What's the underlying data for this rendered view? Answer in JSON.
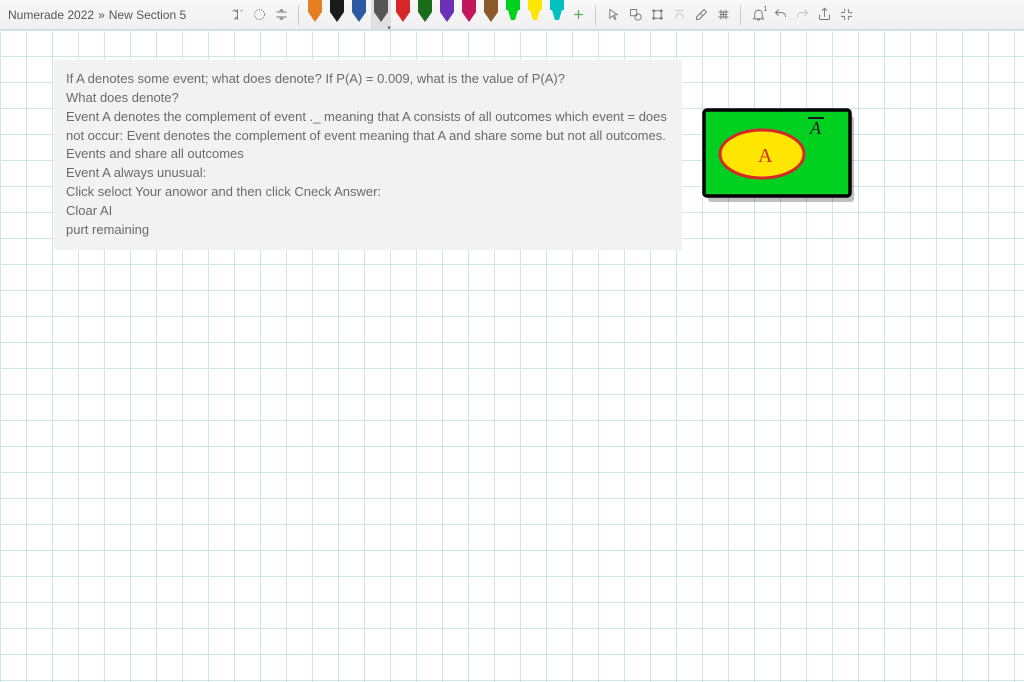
{
  "breadcrumb": {
    "project": "Numerade 2022",
    "separator": "»",
    "section": "New Section 5"
  },
  "pens": [
    {
      "type": "pen",
      "color": "#e67e22",
      "selected": false
    },
    {
      "type": "pen",
      "color": "#1a1a1a",
      "selected": false
    },
    {
      "type": "pen",
      "color": "#2c5aa0",
      "selected": false
    },
    {
      "type": "pen",
      "color": "#555555",
      "selected": true
    },
    {
      "type": "pen",
      "color": "#d62828",
      "selected": false
    },
    {
      "type": "pen",
      "color": "#1a6b1a",
      "selected": false
    },
    {
      "type": "pen",
      "color": "#6b2fb8",
      "selected": false
    },
    {
      "type": "pen",
      "color": "#c2185b",
      "selected": false
    },
    {
      "type": "pen",
      "color": "#8a5a2b",
      "selected": false
    },
    {
      "type": "highlighter",
      "color": "#00d020",
      "selected": false
    },
    {
      "type": "highlighter",
      "color": "#ffe600",
      "selected": false
    },
    {
      "type": "highlighter",
      "color": "#00c0c0",
      "selected": false
    }
  ],
  "content": {
    "line1": "If A denotes some event; what does denote? If P(A) = 0.009, what is the value of P(A)?",
    "line2": "What does denote?",
    "line3": "Event A denotes the complement of event ._ meaning that A consists of all outcomes which event = does not occur: Event denotes the complement of event meaning that A and share some but not all outcomes. Events and share all outcomes",
    "line4": "Event A always unusual:",
    "line5": "Click seloct Your anowor and then click Cneck Answer:",
    "line6": "Cloar AI",
    "line7": "purt remaining"
  },
  "drawing": {
    "labelInside": "A",
    "labelOutside": "A̅"
  }
}
